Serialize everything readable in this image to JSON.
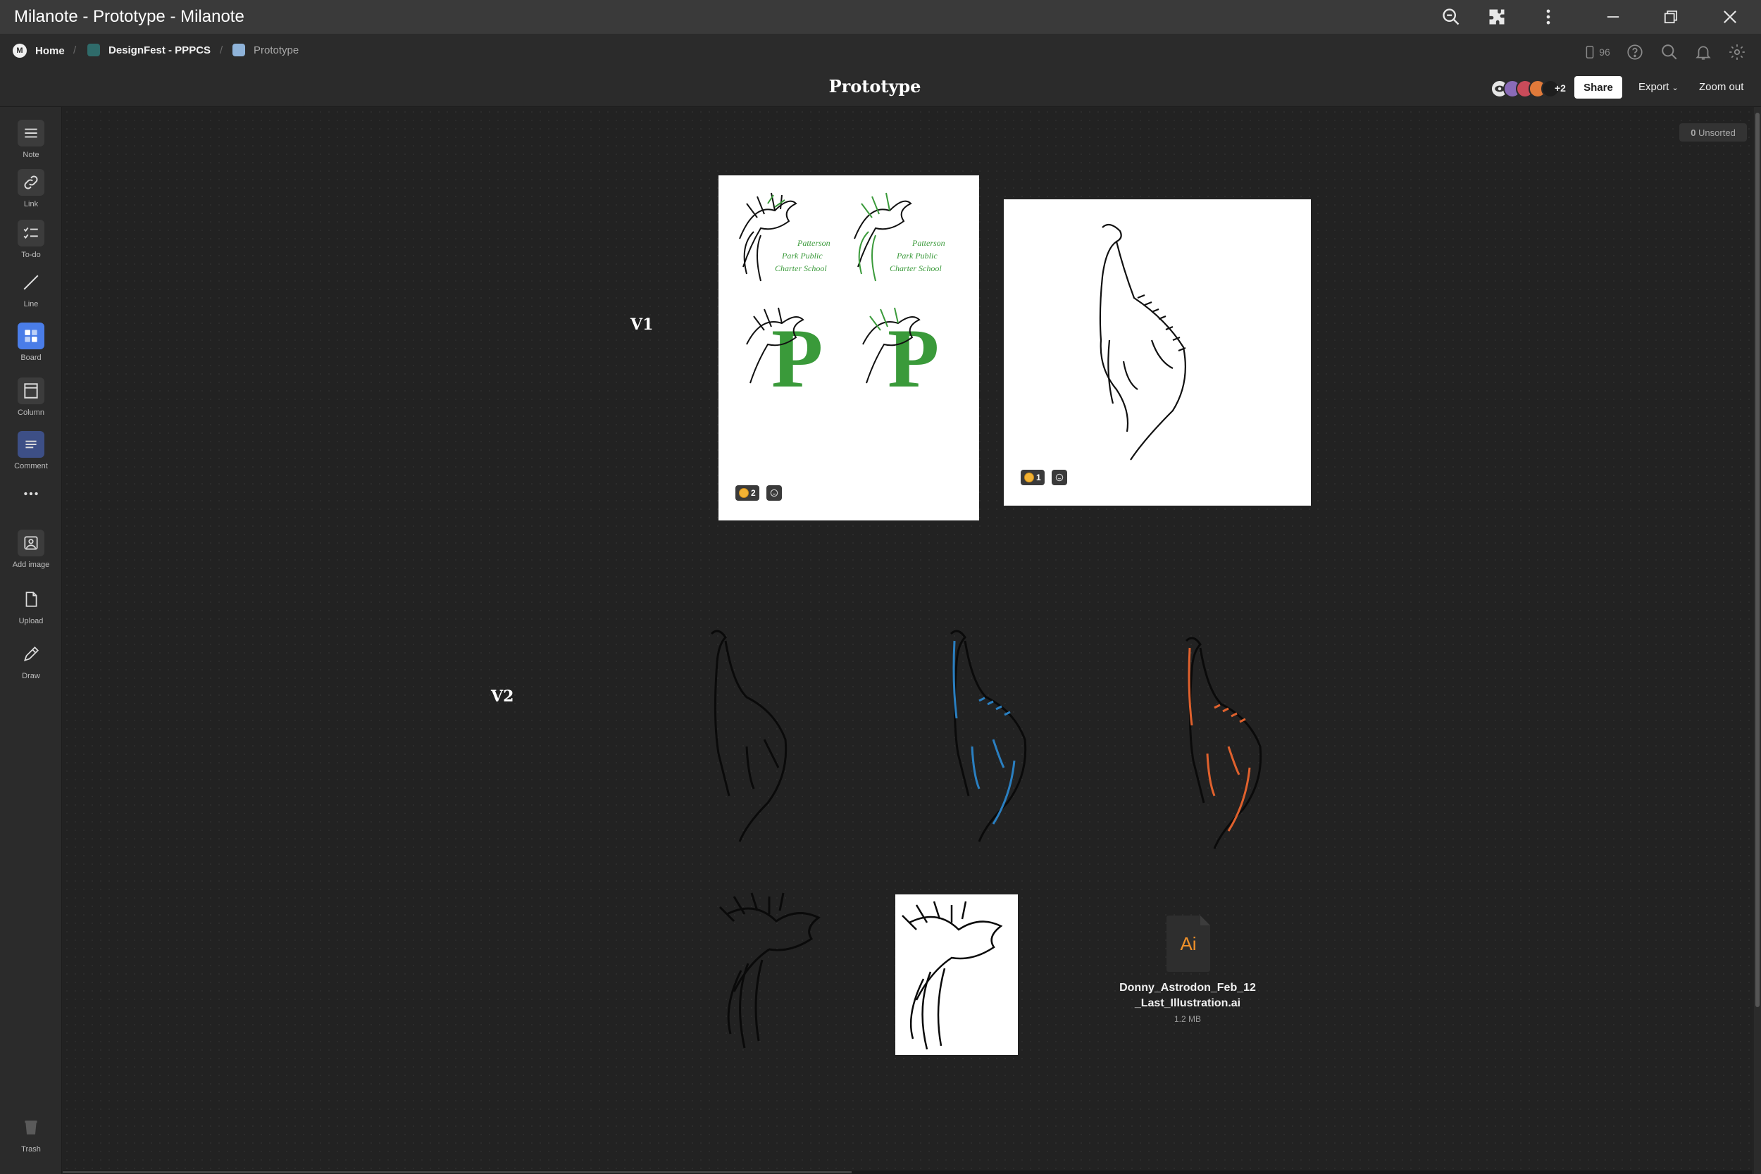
{
  "window": {
    "title": "Milanote - Prototype - Milanote"
  },
  "breadcrumb": {
    "home": "Home",
    "board": "DesignFest - PPPCS",
    "current": "Prototype",
    "separator": "/"
  },
  "header": {
    "page_title": "Prototype",
    "device_count": "96",
    "extra_viewers": "+2",
    "share_label": "Share",
    "export_label": "Export",
    "zoom_label": "Zoom out"
  },
  "toolbar": {
    "items": [
      {
        "label": "Note",
        "icon": "note-icon"
      },
      {
        "label": "Link",
        "icon": "link-icon"
      },
      {
        "label": "To-do",
        "icon": "todo-icon"
      },
      {
        "label": "Line",
        "icon": "line-icon"
      },
      {
        "label": "Board",
        "icon": "board-icon"
      },
      {
        "label": "Column",
        "icon": "column-icon"
      },
      {
        "label": "Comment",
        "icon": "comment-icon"
      },
      {
        "label": "",
        "icon": "more-icon"
      },
      {
        "label": "Add image",
        "icon": "add-image-icon"
      },
      {
        "label": "Upload",
        "icon": "upload-icon"
      },
      {
        "label": "Draw",
        "icon": "draw-icon"
      },
      {
        "label": "Trash",
        "icon": "trash-icon"
      }
    ]
  },
  "canvas": {
    "unsorted_count": "0",
    "unsorted_label": "Unsorted",
    "section_v1": "V1",
    "section_v2": "V2",
    "v1_card1": {
      "logo_text_line1": "Patterson",
      "logo_text_line2": "Park Public",
      "logo_text_line3": "Charter School",
      "logo_letter": "P",
      "reaction_count": "2"
    },
    "v1_card2": {
      "reaction_count": "1"
    },
    "file": {
      "name_line1": "Donny_Astrodon_Feb_12",
      "name_line2": "_Last_Illustration.ai",
      "size": "1.2 MB",
      "type_label": "Ai"
    }
  },
  "colors": {
    "accent_blue": "#4a7de8",
    "logo_green": "#3a9a3a",
    "dino_blue": "#2a7fc1",
    "dino_orange": "#e0612d",
    "ai_orange": "#f0912a"
  }
}
